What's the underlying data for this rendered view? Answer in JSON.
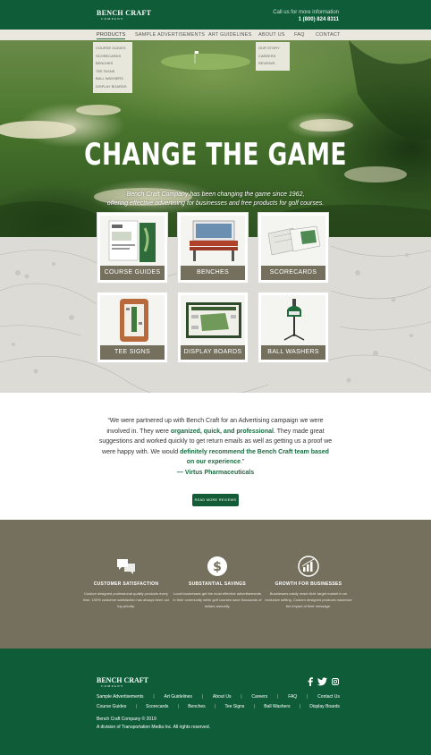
{
  "header": {
    "logo_line1": "BENCH CRAFT",
    "logo_line2": "COMPANY",
    "call_text": "Call us for more information",
    "phone": "1 (800) 824 8311"
  },
  "nav": {
    "items": [
      "PRODUCTS",
      "SAMPLE ADVERTISEMENTS",
      "ART GUIDELINES",
      "ABOUT US",
      "FAQ",
      "CONTACT"
    ],
    "products_menu": [
      "COURSE GUIDES",
      "SCORECARDS",
      "BENCHES",
      "TEE SIGNS",
      "BALL WASHERS",
      "DISPLAY BOARDS"
    ],
    "about_menu": [
      "OUR STORY",
      "CAREERS",
      "REVIEWS"
    ]
  },
  "hero": {
    "title": "CHANGE THE GAME",
    "subtitle_line1": "Bench Craft Company has been changing the game since 1962,",
    "subtitle_line2": "offering effective advertising for businesses and free products for golf courses."
  },
  "products": [
    {
      "label": "COURSE GUIDES",
      "icon": "course-guide-icon"
    },
    {
      "label": "BENCHES",
      "icon": "bench-icon"
    },
    {
      "label": "SCORECARDS",
      "icon": "scorecard-icon"
    },
    {
      "label": "TEE SIGNS",
      "icon": "tee-sign-icon"
    },
    {
      "label": "DISPLAY BOARDS",
      "icon": "display-board-icon"
    },
    {
      "label": "BALL WASHERS",
      "icon": "ball-washer-icon"
    }
  ],
  "testimonial": {
    "p1": "“We were partnered up with Bench Craft for an Advertising campaign we were involved in. They were ",
    "h1": "organized, quick, and professional",
    "p2": ". They made great suggestions and worked quickly to get return emails as well as getting us a proof we were happy with. We would ",
    "h2": "definitely recommend the Bench Craft team based on our experience",
    "p3": ".”",
    "author": "— Virtus Pharmaceuticals",
    "button": "READ MORE REVIEWS"
  },
  "features": [
    {
      "title": "CUSTOMER SATISFACTION",
      "desc": "Custom designed professional quality products every time. 100% customer satisfaction has always been our top priority.",
      "icon": "chat-bubbles-icon"
    },
    {
      "title": "SUBSTANTIAL SAVINGS",
      "desc": "Local businesses get the most effective advertisements in their community while golf courses save thousands of dollars annually.",
      "icon": "dollar-coin-icon"
    },
    {
      "title": "GROWTH FOR BUSINESSES",
      "desc": "Businesses easily reach their target market in an exclusive setting. Custom designed products maximize the impact of their message.",
      "icon": "growth-chart-icon"
    }
  ],
  "footer": {
    "logo_line1": "BENCH CRAFT",
    "logo_line2": "COMPANY",
    "links_row1": [
      "Sample Advertisements",
      "Art Guidelines",
      "About Us",
      "Careers",
      "FAQ",
      "Contact Us"
    ],
    "links_row2": [
      "Course Guides",
      "Scorecards",
      "Benches",
      "Tee Signs",
      "Ball Washers",
      "Display Boards"
    ],
    "separator": "|",
    "copyright": "Bench Craft Company © 2019",
    "division": "A division of Transportation Media Inc. All rights reserved.",
    "social": [
      "facebook-icon",
      "twitter-icon",
      "instagram-icon"
    ]
  },
  "colors": {
    "brand_green": "#0f5c39",
    "accent_green": "#1c6b42",
    "taupe": "#75705d"
  }
}
